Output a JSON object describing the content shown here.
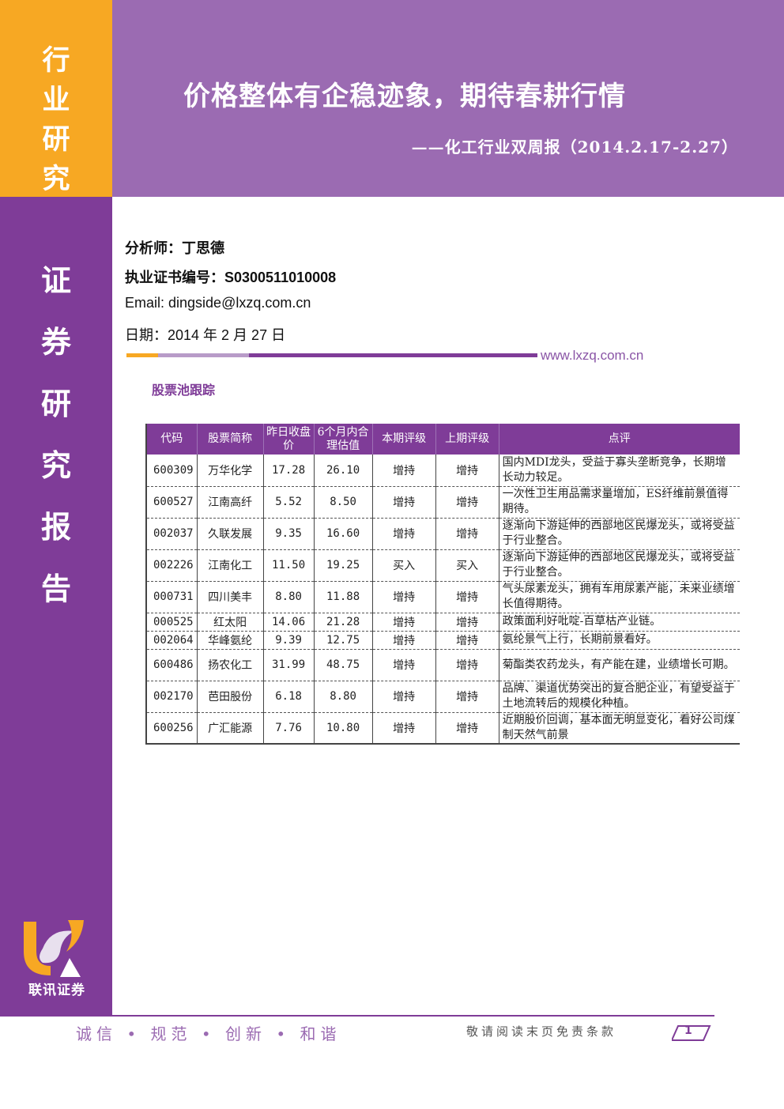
{
  "header": {
    "side_label": "行业研究",
    "title": "价格整体有企稳迹象，期待春耕行情",
    "subtitle": "——化工行业双周报（2014.2.17-2.27）"
  },
  "sidebar": {
    "label": "证券研究报告",
    "logo_text": "联讯证券"
  },
  "meta": {
    "analyst": "分析师：丁思德",
    "cert": "执业证书编号：S0300511010008",
    "email": "Email: dingside@lxzq.com.cn",
    "date": "日期：2014 年 2 月 27 日",
    "website": "www.lxzq.com.cn"
  },
  "section_title": "股票池跟踪",
  "table": {
    "headers": [
      "代码",
      "股票简称",
      "昨日收盘价",
      "6个月内合理估值",
      "本期评级",
      "上期评级",
      "点评"
    ],
    "rows": [
      {
        "code": "600309",
        "name": "万华化学",
        "close": "17.28",
        "value": "26.10",
        "cur": "增持",
        "prev": "增持",
        "comment": "国内MDI龙头，受益于寡头垄断竞争，长期增长动力较足。"
      },
      {
        "code": "600527",
        "name": "江南高纤",
        "close": "5.52",
        "value": "8.50",
        "cur": "增持",
        "prev": "增持",
        "comment": "一次性卫生用品需求量增加，ES纤维前景值得期待。"
      },
      {
        "code": "002037",
        "name": "久联发展",
        "close": "9.35",
        "value": "16.60",
        "cur": "增持",
        "prev": "增持",
        "comment": "逐渐向下游延伸的西部地区民爆龙头，或将受益于行业整合。"
      },
      {
        "code": "002226",
        "name": "江南化工",
        "close": "11.50",
        "value": "19.25",
        "cur": "买入",
        "prev": "买入",
        "comment": "逐渐向下游延伸的西部地区民爆龙头，或将受益于行业整合。"
      },
      {
        "code": "000731",
        "name": "四川美丰",
        "close": "8.80",
        "value": "11.88",
        "cur": "增持",
        "prev": "增持",
        "comment": "气头尿素龙头，拥有车用尿素产能，未来业绩增长值得期待。"
      },
      {
        "code": "000525",
        "name": "红太阳",
        "close": "14.06",
        "value": "21.28",
        "cur": "增持",
        "prev": "增持",
        "comment": "政策面利好吡啶-百草枯产业链。"
      },
      {
        "code": "002064",
        "name": "华峰氨纶",
        "close": "9.39",
        "value": "12.75",
        "cur": "增持",
        "prev": "增持",
        "comment": "氨纶景气上行，长期前景看好。"
      },
      {
        "code": "600486",
        "name": "扬农化工",
        "close": "31.99",
        "value": "48.75",
        "cur": "增持",
        "prev": "增持",
        "comment": "菊酯类农药龙头，有产能在建，业绩增长可期。"
      },
      {
        "code": "002170",
        "name": "芭田股份",
        "close": "6.18",
        "value": "8.80",
        "cur": "增持",
        "prev": "增持",
        "comment": "品牌、渠道优势突出的复合肥企业，有望受益于土地流转后的规模化种植。"
      },
      {
        "code": "600256",
        "name": "广汇能源",
        "close": "7.76",
        "value": "10.80",
        "cur": "增持",
        "prev": "增持",
        "comment": "近期股价回调，基本面无明显变化，看好公司煤制天然气前景"
      }
    ]
  },
  "footer": {
    "motto": "诚信 • 规范 • 创新 • 和谐",
    "disclaimer": "敬请阅读末页免责条款",
    "page": "1"
  },
  "colors": {
    "purple": "#7f3c98",
    "light_purple": "#9b6bb2",
    "orange": "#f7a823"
  }
}
